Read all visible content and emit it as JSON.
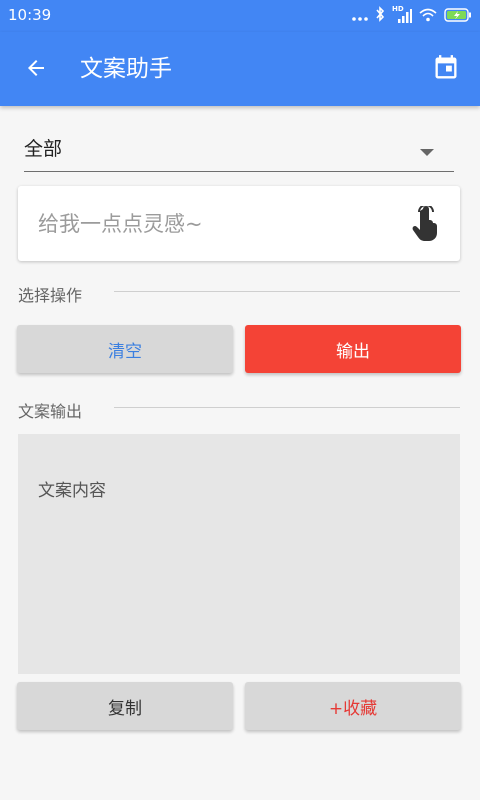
{
  "status_bar": {
    "time": "10:39",
    "hd_label": "HD"
  },
  "app_bar": {
    "title": "文案助手",
    "color": "#4286f4"
  },
  "filter": {
    "selected": "全部"
  },
  "inspiration_input": {
    "value": "",
    "placeholder": "给我一点点灵感~"
  },
  "operations": {
    "section_label": "选择操作",
    "clear_label": "清空",
    "output_label": "输出",
    "output_color": "#f44336"
  },
  "result": {
    "section_label": "文案输出",
    "content": "文案内容"
  },
  "actions": {
    "copy_label": "复制",
    "favorite_label": "+收藏"
  },
  "icons": {
    "back": "arrow-left-icon",
    "calendar": "calendar-icon",
    "dropdown": "caret-down-icon",
    "touch": "touch-hand-icon"
  }
}
